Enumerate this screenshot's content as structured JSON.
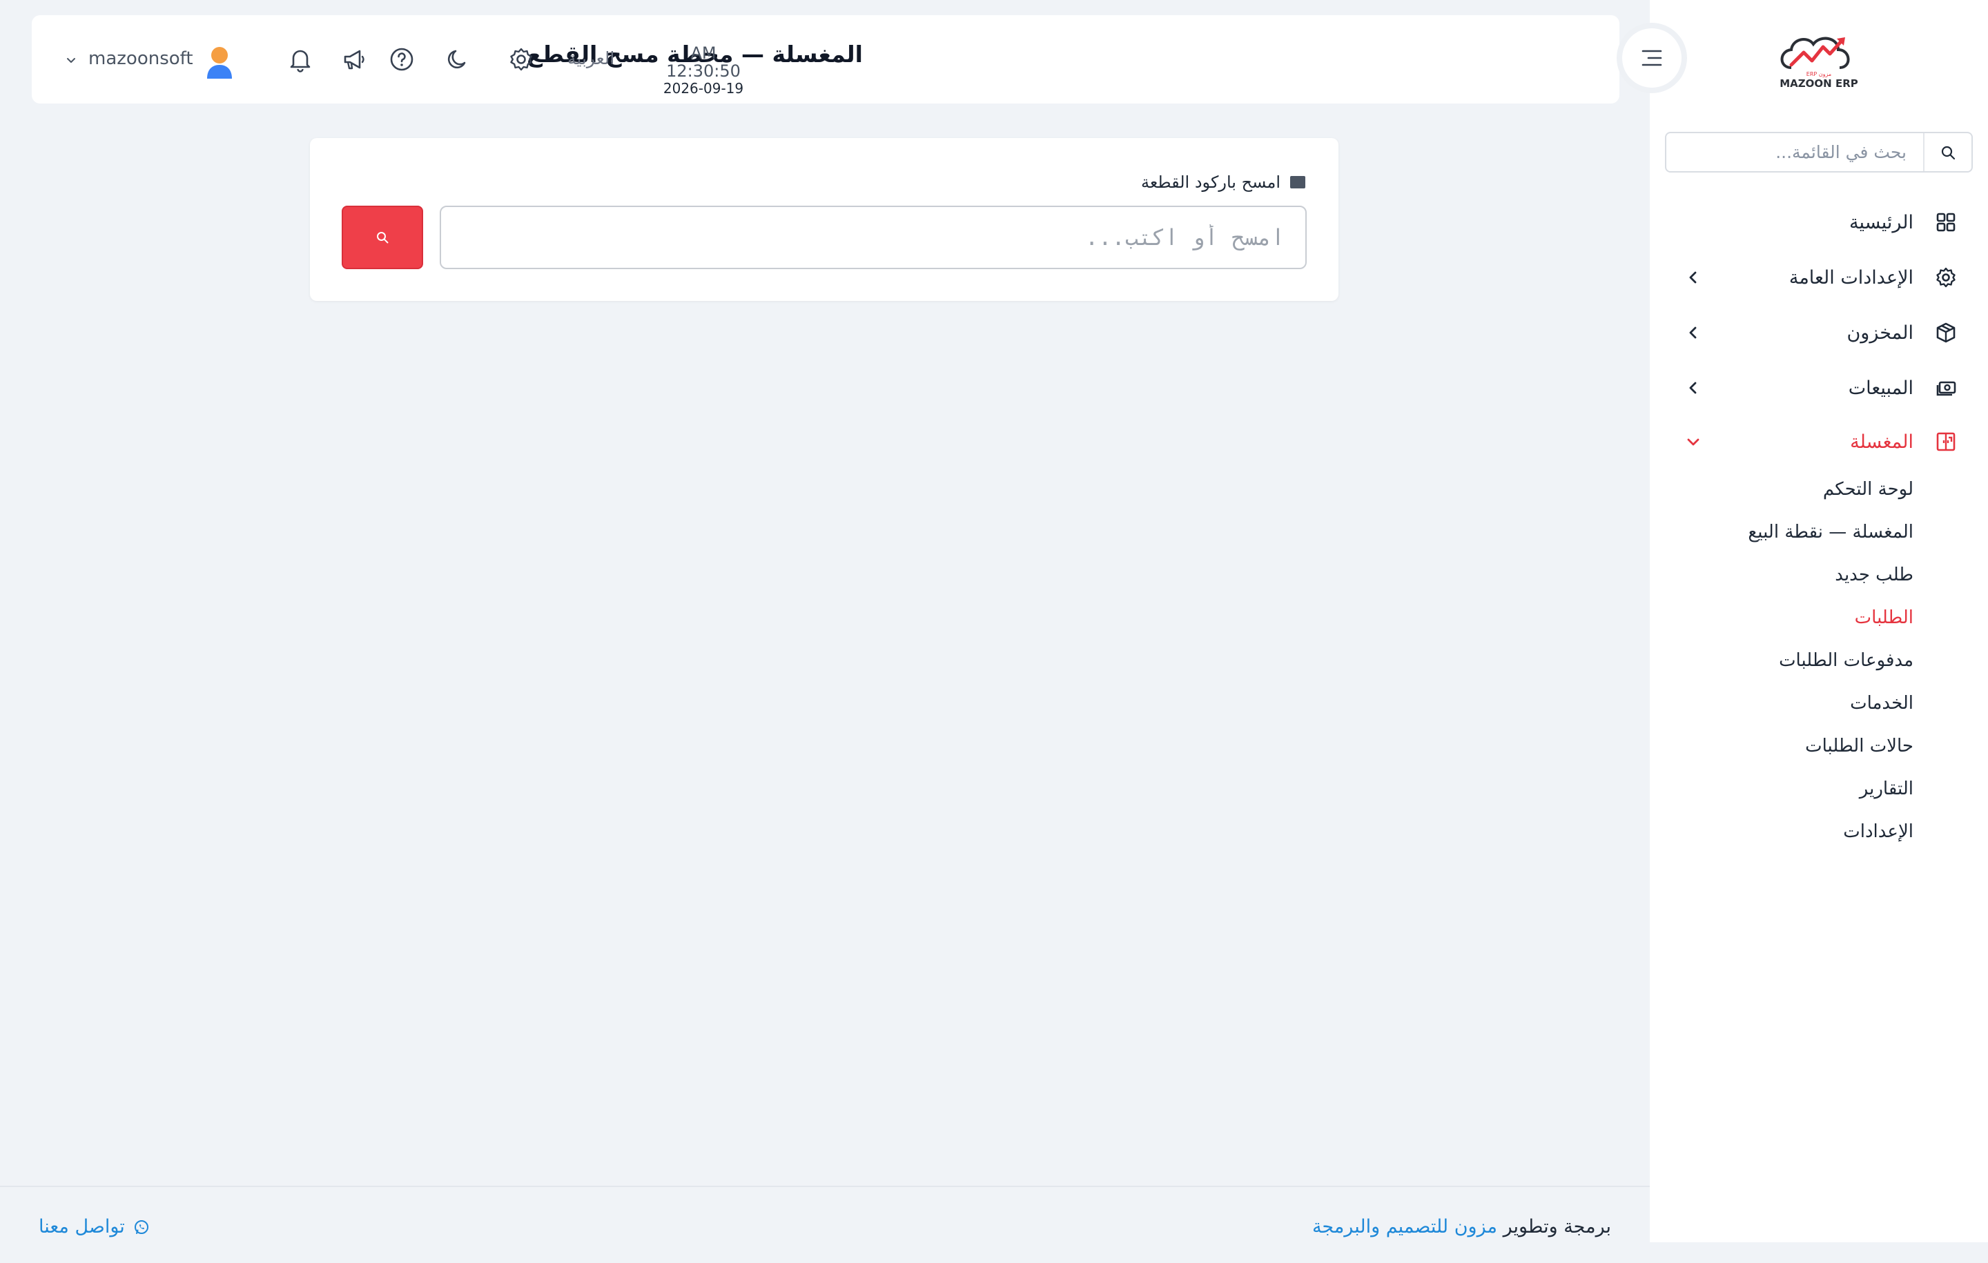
{
  "colors": {
    "accent": "#e5343f",
    "link": "#1e88d8",
    "background": "#f0f3f7",
    "panel": "#ffffff"
  },
  "sidebar": {
    "logo_text": "MAZOON ERP",
    "logo_sub": "ERP مزون",
    "search_placeholder": "بحث في القائمة...",
    "items": [
      {
        "label": "الرئيسية",
        "icon": "grid-icon"
      },
      {
        "label": "الإعدادات العامة",
        "icon": "gear-icon"
      },
      {
        "label": "المخزون",
        "icon": "box-icon"
      },
      {
        "label": "المبيعات",
        "icon": "cash-icon"
      },
      {
        "label": "المغسلة",
        "icon": "wardrobe-icon"
      }
    ],
    "laundry_sub": [
      {
        "label": "لوحة التحكم"
      },
      {
        "label": "المغسلة — نقطة البيع"
      },
      {
        "label": "طلب جديد"
      },
      {
        "label": "الطلبات"
      },
      {
        "label": "مدفوعات الطلبات"
      },
      {
        "label": "الخدمات"
      },
      {
        "label": "حالات الطلبات"
      },
      {
        "label": "التقارير"
      },
      {
        "label": "الإعدادات"
      }
    ]
  },
  "header": {
    "title": "المغسلة — محطة مسح القطع",
    "time": "AM 12:30:50",
    "date": "2026-09-19",
    "language": "العربية",
    "username": "mazoonsoft"
  },
  "scan": {
    "label": "امسح باركود القطعة",
    "placeholder": "امسح أو اكتب..."
  },
  "footer": {
    "credit_prefix": "برمجة وتطوير",
    "credit_link": "مزون للتصميم والبرمجة",
    "contact": "تواصل معنا"
  }
}
